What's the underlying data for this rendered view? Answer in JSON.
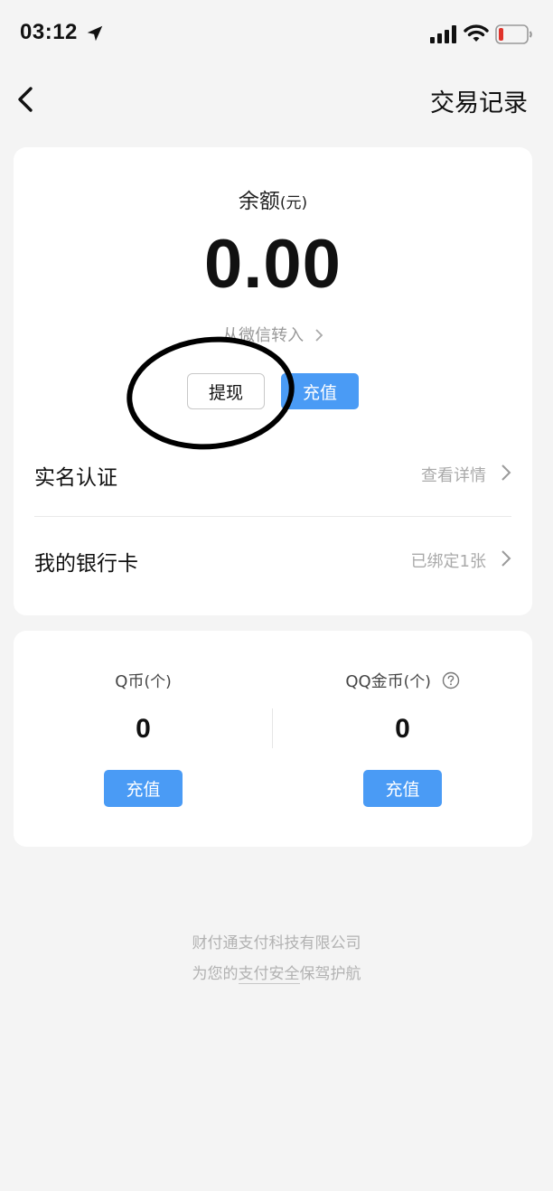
{
  "status_bar": {
    "time": "03:12"
  },
  "nav": {
    "right_label": "交易记录"
  },
  "balance": {
    "label": "余额",
    "unit": "(元)",
    "amount": "0.00",
    "transfer_link": "从微信转入",
    "withdraw_label": "提现",
    "recharge_label": "充值"
  },
  "rows": [
    {
      "title": "实名认证",
      "value": "查看详情"
    },
    {
      "title": "我的银行卡",
      "value": "已绑定1张"
    }
  ],
  "coins": {
    "q_coin": {
      "label": "Q币",
      "unit": "(个)",
      "value": "0",
      "button": "充值"
    },
    "qq_gold": {
      "label": "QQ金币",
      "unit": "(个)",
      "value": "0",
      "button": "充值"
    }
  },
  "footer": {
    "line1": "财付通支付科技有限公司",
    "line2_prefix": "为您的",
    "line2_link": "支付安全",
    "line2_suffix": "保驾护航"
  },
  "colors": {
    "accent": "#4a9bf5",
    "background": "#f4f4f4",
    "battery_low": "#e0332b"
  }
}
